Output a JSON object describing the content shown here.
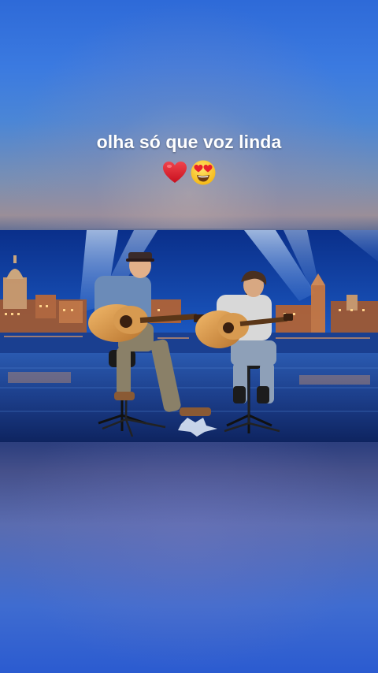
{
  "caption": {
    "text": "olha só que voz linda",
    "emojis": [
      "red-heart-emoji",
      "heart-eyes-emoji"
    ]
  },
  "video": {
    "subject": "two-guitarists-on-talent-show-stage"
  }
}
